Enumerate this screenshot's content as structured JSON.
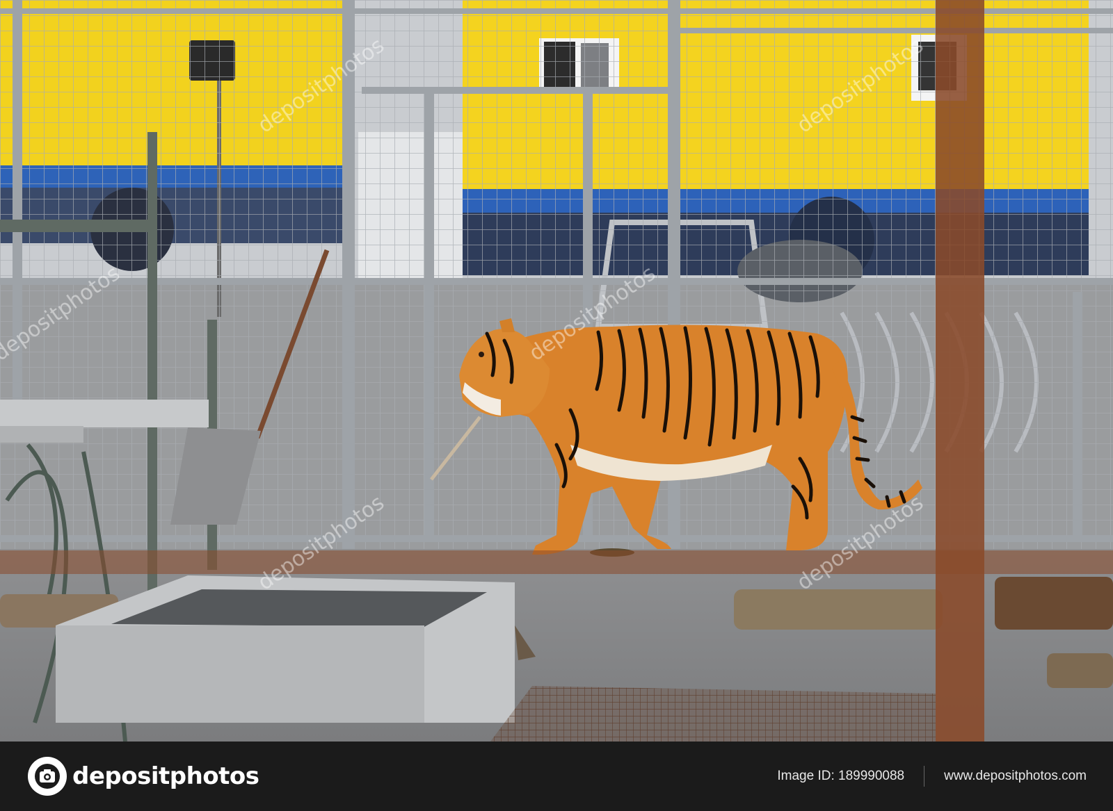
{
  "photo": {
    "subject": "tiger-icon",
    "watermark_text": "depositphotos"
  },
  "footer": {
    "logo_text": "depositphotos",
    "image_id": "Image ID: 189990088",
    "site": "www.depositphotos.com"
  },
  "colors": {
    "footer_bg": "#1b1b1b",
    "trailer_yellow": "#f2d21e",
    "trailer_blue": "#2e63b8",
    "tiger_orange": "#d9822b",
    "rust_bar": "#8a4a2a"
  }
}
